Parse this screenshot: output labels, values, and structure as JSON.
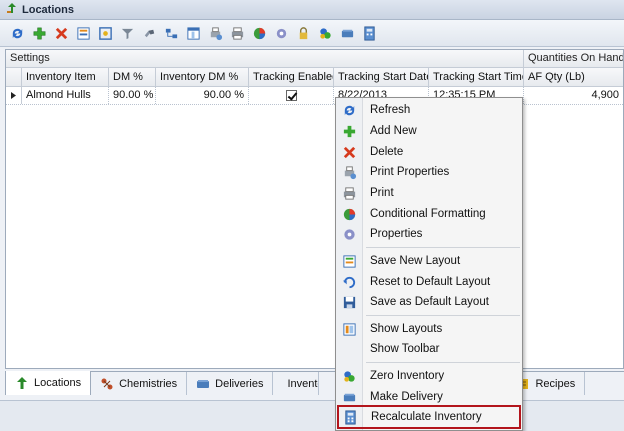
{
  "window": {
    "title": "Locations"
  },
  "toolbar": {
    "icons": [
      "refresh-icon",
      "add-icon",
      "delete-icon",
      "properties-icon",
      "layout-icon",
      "filter-icon",
      "link-icon",
      "tree-icon",
      "column-icon",
      "print-properties-icon",
      "print-icon",
      "conditional-formatting-icon",
      "settings-icon",
      "lock-icon",
      "zero-inventory-icon",
      "make-delivery-icon",
      "recalculate-icon"
    ]
  },
  "grid": {
    "bands": {
      "settings": "Settings",
      "quantities": "Quantities On Hand"
    },
    "columns": [
      "Inventory Item",
      "DM %",
      "Inventory DM %",
      "Tracking Enabled",
      "Tracking Start Date",
      "Tracking Start Time",
      "AF Qty (Lb)"
    ],
    "rows": [
      {
        "item": "Almond Hulls",
        "dm": "90.00 %",
        "inv_dm": "90.00 %",
        "tracking": true,
        "start_date": "8/22/2013",
        "start_time": "12:35:15 PM",
        "af_qty": "4,900"
      }
    ]
  },
  "tabs": [
    {
      "label": "Locations",
      "icon": "location-icon",
      "active": true
    },
    {
      "label": "Chemistries",
      "icon": "chemistry-icon",
      "active": false
    },
    {
      "label": "Deliveries",
      "icon": "delivery-icon",
      "active": false
    },
    {
      "label": "Inventory",
      "icon": "inventory-icon",
      "active": false
    },
    {
      "label": "Recipes",
      "icon": "recipe-icon",
      "active": false
    }
  ],
  "context_menu": {
    "items": [
      {
        "label": "Refresh",
        "icon": "refresh-icon"
      },
      {
        "label": "Add New",
        "icon": "add-icon"
      },
      {
        "label": "Delete",
        "icon": "delete-icon"
      },
      {
        "label": "Print Properties",
        "icon": "print-properties-icon"
      },
      {
        "label": "Print",
        "icon": "print-icon"
      },
      {
        "label": "Conditional Formatting",
        "icon": "conditional-formatting-icon"
      },
      {
        "label": "Properties",
        "icon": "gear-icon"
      },
      {
        "label": "Save New Layout",
        "icon": "save-layout-icon"
      },
      {
        "label": "Reset to Default Layout",
        "icon": "reset-layout-icon"
      },
      {
        "label": "Save as Default Layout",
        "icon": "save-icon"
      },
      {
        "label": "Show Layouts",
        "icon": "show-layouts-icon"
      },
      {
        "label": "Show Toolbar",
        "icon": ""
      },
      {
        "label": "Zero Inventory",
        "icon": "zero-inventory-icon"
      },
      {
        "label": "Make Delivery",
        "icon": "make-delivery-icon"
      },
      {
        "label": "Recalculate Inventory",
        "icon": "recalculate-icon",
        "highlighted": true
      }
    ]
  },
  "colors": {
    "highlight_border": "#b3151c",
    "accent_blue": "#2e6cc8"
  }
}
